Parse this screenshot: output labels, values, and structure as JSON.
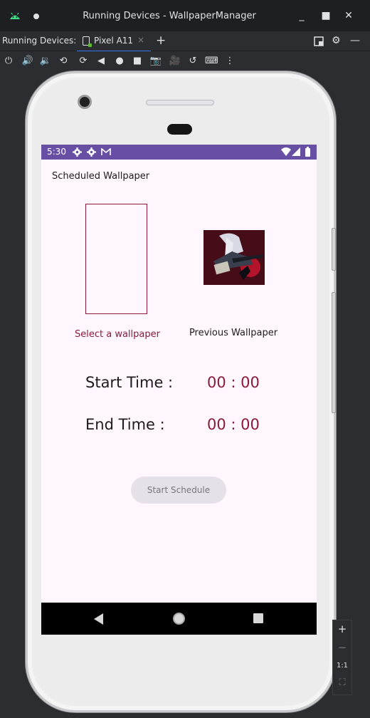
{
  "window": {
    "title": "Running Devices - WallpaperManager",
    "minimize_label": "_",
    "maximize_label": "■",
    "close_label": "✕"
  },
  "tool_window": {
    "title": "Running Devices:",
    "tab_label": "Pixel A11",
    "tab_close": "×",
    "add_label": "+",
    "settings_glyph": "⚙",
    "hide_glyph": "—"
  },
  "toolbar": {
    "icons": [
      "power-icon",
      "volume-up-icon",
      "volume-down-icon",
      "rotate-left-icon",
      "rotate-right-icon",
      "back-icon",
      "home-icon",
      "overview-icon",
      "screenshot-icon",
      "screen-record-icon",
      "snapshot-icon",
      "keyboard-icon",
      "more-options-icon"
    ],
    "glyphs": [
      "⏻",
      "🔊",
      "🔉",
      "⟲",
      "⟳",
      "◀",
      "●",
      "■",
      "📷",
      "🎥",
      "↺",
      "⌨",
      "⋮"
    ]
  },
  "device": {
    "status_bar": {
      "time": "5:30"
    },
    "app": {
      "title": "Scheduled Wallpaper",
      "select_wallpaper_label": "Select a wallpaper",
      "previous_wallpaper_label": "Previous Wallpaper",
      "start_time_label": "Start Time :",
      "start_time_value": "00 : 00",
      "end_time_label": "End Time :",
      "end_time_value": "00 : 00",
      "start_schedule_label": "Start Schedule"
    }
  },
  "zoom": {
    "zoom_in": "+",
    "zoom_out": "−",
    "actual_size": "1:1",
    "fit_screen": "⛶"
  },
  "colors": {
    "status_bar": "#6750a4",
    "accent": "#8b1a3a",
    "screen_bg": "#fff7fd"
  }
}
